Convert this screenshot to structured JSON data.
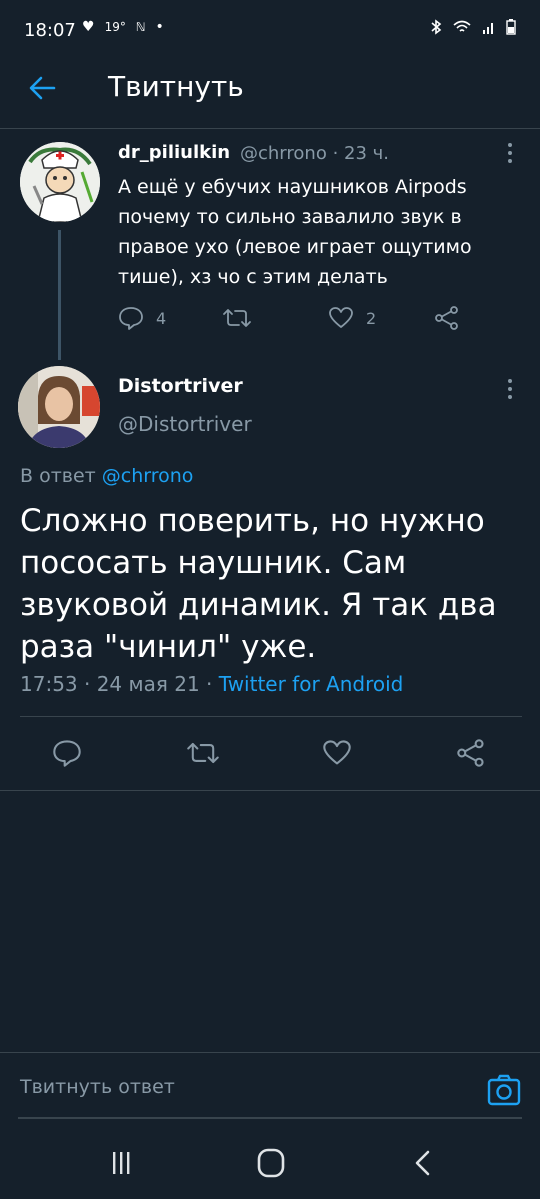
{
  "status_bar": {
    "time": "18:07",
    "temp": "19°",
    "dot": "•"
  },
  "header": {
    "title": "Твитнуть"
  },
  "reply_tweet": {
    "name": "dr_piliulkin",
    "handle": "@chrrono",
    "time": "23 ч.",
    "text": "А ещё у ебучих наушников Airpods почему то сильно завалило звук в правое ухо (левое играет ощутимо тише), хз чо с этим делать",
    "reply_count": "4",
    "like_count": "2"
  },
  "main_tweet": {
    "name": "Distortriver",
    "handle": "@Distortriver",
    "reply_to_prefix": "В ответ",
    "reply_to_handle": "@chrrono",
    "text": "Сложно поверить, но нужно пососать наушник. Сам звуковой динамик. Я так два раза \"чинил\" уже.",
    "datetime": "17:53 · 24 мая 21 ·",
    "source": "Twitter for Android"
  },
  "composer": {
    "placeholder": "Твитнуть ответ"
  },
  "colors": {
    "background": "#15202b",
    "accent": "#1da1f2",
    "muted": "#8899a6",
    "divider": "#38444d"
  }
}
